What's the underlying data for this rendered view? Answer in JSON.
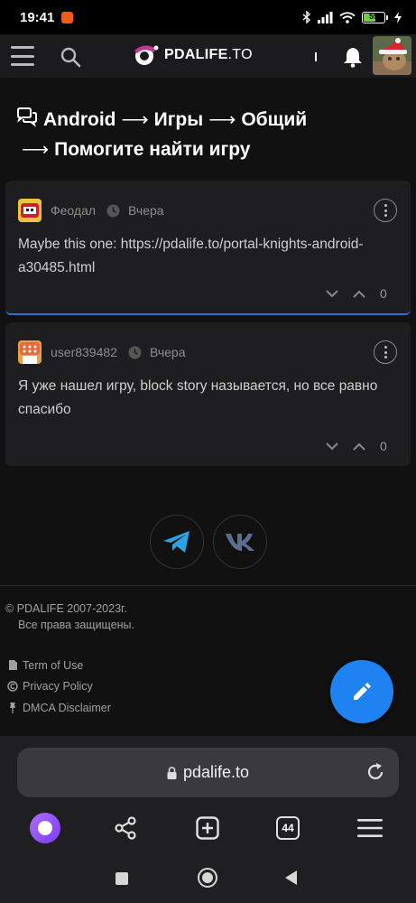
{
  "status_bar": {
    "time": "19:41",
    "battery": "59"
  },
  "header": {
    "logo_main": "PDALIFE",
    "logo_suffix": ".TO"
  },
  "breadcrumb": {
    "items": [
      "Android",
      "Игры",
      "Общий",
      "Помогите найти игру"
    ],
    "separator": "⟶"
  },
  "comments": [
    {
      "user": "Феодал",
      "time": "Вчера",
      "text": "Maybe this one: https://pdalife.to/portal-knights-android-a30485.html",
      "votes": "0"
    },
    {
      "user": "user839482",
      "time": "Вчера",
      "text": "Я уже нашел игру, block story называется, но все равно спасибо",
      "votes": "0"
    }
  ],
  "footer": {
    "copyright_line1": "© PDALIFE 2007-2023г.",
    "copyright_line2": "Все права защищены.",
    "links": [
      "Term of Use",
      "Privacy Policy",
      "DMCA Disclaimer"
    ]
  },
  "browser": {
    "url": "pdalife.to",
    "tabs_count": "44"
  },
  "colors": {
    "accent": "#1e83f0",
    "telegram": "#2aa3e0",
    "vk": "#5a6f8f",
    "comment_focus": "#2b6fd6"
  },
  "icons": [
    "hamburger-menu-icon",
    "search-icon",
    "bell-icon",
    "chat-bubbles-icon",
    "clock-icon",
    "more-vertical-icon",
    "chevron-down-icon",
    "chevron-up-icon",
    "telegram-icon",
    "vk-icon",
    "file-icon",
    "copyright-icon",
    "pin-icon",
    "pencil-icon",
    "lock-icon",
    "reload-icon",
    "share-icon",
    "add-tab-icon",
    "menu-icon"
  ]
}
